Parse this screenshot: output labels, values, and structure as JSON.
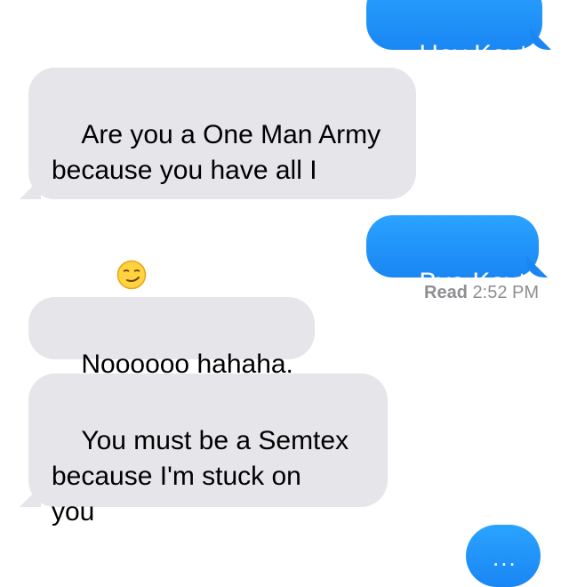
{
  "conversation": {
    "messages": [
      {
        "direction": "sent",
        "text": "Hey Kayt"
      },
      {
        "direction": "received",
        "text": "Are you a One Man Army\nbecause you have all I\nneed",
        "emoji": "smirk-emoji"
      },
      {
        "direction": "sent",
        "text": "Bye Kayt"
      },
      {
        "direction": "received",
        "text": "Noooooo hahaha."
      },
      {
        "direction": "received",
        "text": "You must be a Semtex\nbecause I'm stuck on\nyou"
      }
    ],
    "read_receipt": {
      "label": "Read",
      "time": "2:52 PM"
    },
    "typing_indicator": "..."
  },
  "colors": {
    "sent_bubble": "#1a86f3",
    "received_bubble": "#e5e5ea",
    "status_text": "#8e8e93"
  }
}
